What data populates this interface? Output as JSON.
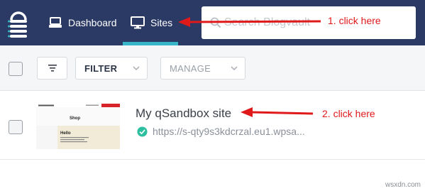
{
  "nav": {
    "dashboard_label": "Dashboard",
    "sites_label": "Sites",
    "active_tab": "Sites",
    "search_placeholder": "Search Blogvault"
  },
  "toolbar": {
    "filter_label": "FILTER",
    "manage_label": "MANAGE"
  },
  "site": {
    "name": "My qSandbox site",
    "url": "https://s-qty9s3kdcrzal.eu1.wpsa...",
    "status": "verified",
    "thumbnail": {
      "title": "Shop",
      "heading": "Hello"
    }
  },
  "annotations": [
    {
      "text": "1. click here"
    },
    {
      "text": "2. click here"
    }
  ],
  "watermark": "wsxdn.com",
  "colors": {
    "nav_bg": "#2a3a64",
    "active_tab_accent": "#36b6c6",
    "verified_green": "#2bbf9f",
    "annotation_red": "#e0191b",
    "toolbar_bg": "#f4f6f8"
  },
  "icons": {
    "logo": "blogvault-logo-icon",
    "dashboard": "dashboard-icon",
    "sites": "monitor-icon",
    "search": "search-icon",
    "sort": "sort-icon",
    "chevron": "chevron-down-icon",
    "status": "check-circle-icon"
  }
}
